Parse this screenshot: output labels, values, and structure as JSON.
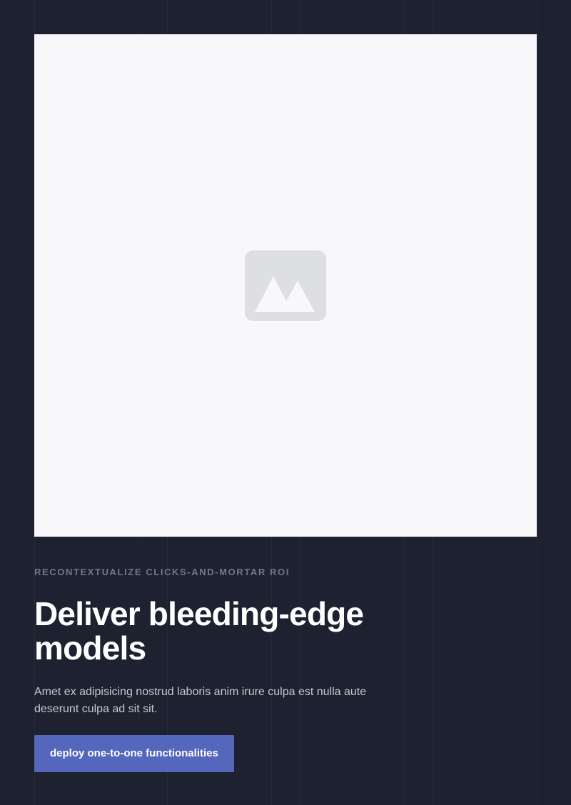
{
  "hero": {
    "image_alt": "image-placeholder",
    "eyebrow": "RECONTEXTUALIZE CLICKS-AND-MORTAR ROI",
    "title": "Deliver bleeding-edge models",
    "body": "Amet ex adipisicing nostrud laboris anim irure culpa est nulla aute deserunt culpa ad sit sit.",
    "cta_label": "deploy one-to-one functionalities"
  },
  "icons": {
    "placeholder": "image-placeholder-icon"
  },
  "colors": {
    "background": "#1e2230",
    "card": "#f8f8fa",
    "accent": "#5566bd",
    "eyebrow": "#6f7891",
    "title": "#ffffff",
    "body": "#c5c9d3"
  }
}
